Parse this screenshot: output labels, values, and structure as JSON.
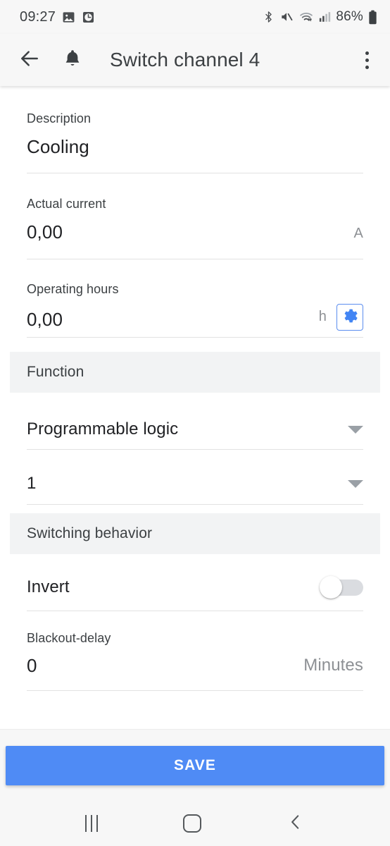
{
  "status_bar": {
    "time": "09:27",
    "left_icons": [
      "photo-icon",
      "alarm-clock-icon"
    ],
    "right_icons": [
      "bluetooth-icon",
      "volume-mute-icon",
      "wifi-icon",
      "cellular-signal-icon"
    ],
    "battery_percent": "86%"
  },
  "app_bar": {
    "back_icon": "back-arrow-icon",
    "bell_icon": "bell-icon",
    "title": "Switch channel 4",
    "overflow_icon": "more-vertical-icon"
  },
  "form": {
    "description": {
      "label": "Description",
      "value": "Cooling",
      "unit": ""
    },
    "actual_current": {
      "label": "Actual current",
      "value": "0,00",
      "unit": "A"
    },
    "operating_hours": {
      "label": "Operating hours",
      "value": "0,00",
      "unit": "h",
      "action_icon": "gear-icon"
    },
    "function_section": {
      "title": "Function"
    },
    "function_select": {
      "value": "Programmable logic"
    },
    "function_index_select": {
      "value": "1"
    },
    "switching_section": {
      "title": "Switching behavior"
    },
    "invert": {
      "label": "Invert",
      "state": "off"
    },
    "blackout_delay": {
      "label": "Blackout-delay",
      "value": "0",
      "unit": "Minutes"
    }
  },
  "footer": {
    "save_label": "SAVE"
  },
  "nav_bar": {
    "recent_label": "recent-apps",
    "home_label": "home",
    "back_label": "back"
  },
  "colors": {
    "accent_blue": "#4f8bf5",
    "gear_blue": "#4285f4",
    "section_gray": "#f2f3f4",
    "bar_gray": "#f7f7f7",
    "text_primary": "#202124",
    "text_secondary": "#8d9094"
  }
}
